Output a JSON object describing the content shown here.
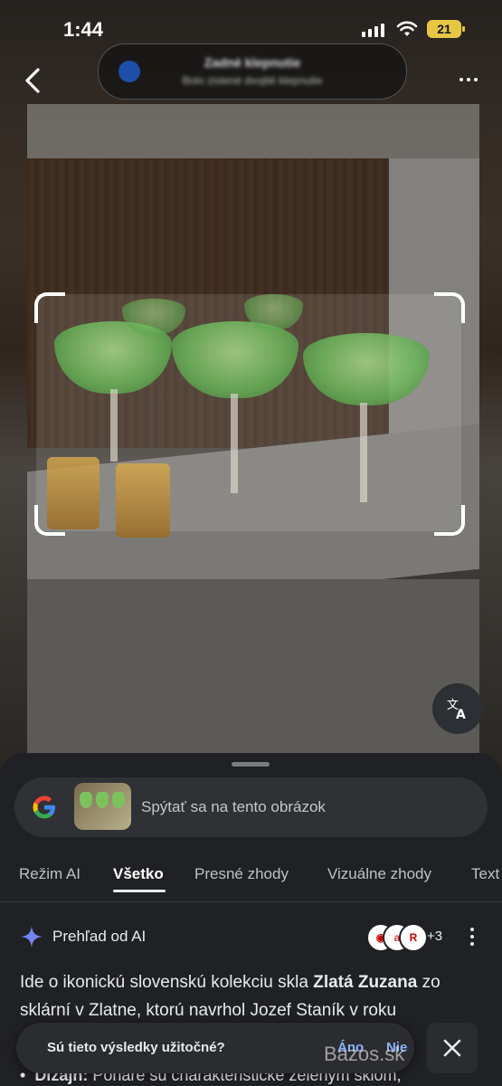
{
  "status": {
    "time": "1:44",
    "battery": "21"
  },
  "toast": {
    "title": "Zadné klepnutie",
    "subtitle": "Bolo zistené dvojité klepnutie"
  },
  "search": {
    "placeholder": "Spýtať sa na tento obrázok"
  },
  "tabs": [
    {
      "label": "Režim AI"
    },
    {
      "label": "Všetko",
      "active": true
    },
    {
      "label": "Presné zhody"
    },
    {
      "label": "Vizuálne zhody"
    },
    {
      "label": "Text"
    }
  ],
  "ai_overview": {
    "title": "Prehľad od AI",
    "source_count": "+3",
    "text_1": "Ide o ikonickú slovenskú kolekciu skla ",
    "highlight": "Zlatá Zuzana",
    "text_2": " zo sklární v Zlatne, ktorú navrhol Jozef Staník v roku",
    "bullet_label": "Dizajn:",
    "bullet_text": " Poháre sú charakteristické zeleným sklom,"
  },
  "feedback": {
    "question": "Sú tieto výsledky užitočné?",
    "yes": "Áno",
    "no": "Nie"
  },
  "watermark": "Bazos.sk",
  "colors": {
    "accent": "#8ab4f8",
    "sheet_bg": "#202124",
    "battery": "#e6c642"
  }
}
